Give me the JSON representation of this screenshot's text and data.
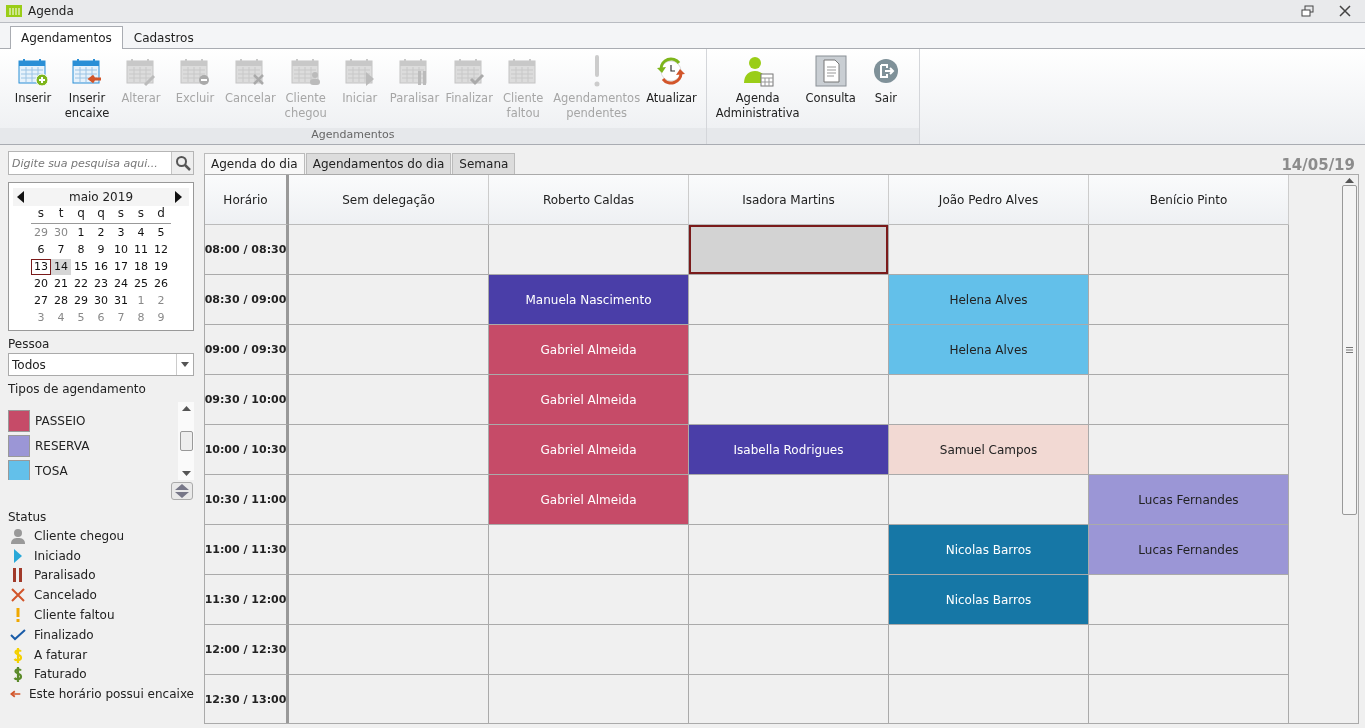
{
  "window": {
    "title": "Agenda"
  },
  "ribbon_tabs": [
    {
      "label": "Agendamentos",
      "selected": true
    },
    {
      "label": "Cadastros",
      "selected": false
    }
  ],
  "ribbon_groups": [
    {
      "label": "Agendamentos",
      "buttons": [
        {
          "lines": [
            "Inserir"
          ],
          "kind": "add",
          "disabled": false
        },
        {
          "lines": [
            "Inserir",
            "encaixe"
          ],
          "kind": "insert",
          "disabled": false
        },
        {
          "lines": [
            "Alterar"
          ],
          "kind": "edit",
          "disabled": true
        },
        {
          "lines": [
            "Excluir"
          ],
          "kind": "remove",
          "disabled": true
        },
        {
          "lines": [
            "Cancelar"
          ],
          "kind": "cancel",
          "disabled": true
        },
        {
          "lines": [
            "Cliente",
            "chegou"
          ],
          "kind": "arrived",
          "disabled": true
        },
        {
          "lines": [
            "Iniciar"
          ],
          "kind": "start",
          "disabled": true
        },
        {
          "lines": [
            "Paralisar"
          ],
          "kind": "pause",
          "disabled": true
        },
        {
          "lines": [
            "Finalizar"
          ],
          "kind": "finish",
          "disabled": true
        },
        {
          "lines": [
            "Cliente",
            "faltou"
          ],
          "kind": "missed",
          "disabled": true
        },
        {
          "lines": [
            "Agendamentos",
            "pendentes"
          ],
          "kind": "pending",
          "disabled": true
        },
        {
          "lines": [
            "Atualizar"
          ],
          "kind": "refresh",
          "disabled": false
        }
      ]
    },
    {
      "buttons": [
        {
          "lines": [
            "Agenda",
            "Administrativa"
          ],
          "kind": "admin",
          "disabled": false
        },
        {
          "lines": [
            "Consulta"
          ],
          "kind": "query",
          "disabled": false
        },
        {
          "lines": [
            "Sair"
          ],
          "kind": "exit",
          "disabled": false
        }
      ]
    }
  ],
  "search": {
    "placeholder": "Digite sua pesquisa aqui..."
  },
  "calendar": {
    "month": "maio 2019",
    "weekdays": [
      "s",
      "t",
      "q",
      "q",
      "s",
      "s",
      "d"
    ],
    "weeks": [
      [
        {
          "day": "29",
          "other_month": true,
          "today": false,
          "selected": false
        },
        {
          "day": "30",
          "other_month": true,
          "today": false,
          "selected": false
        },
        {
          "day": "1",
          "other_month": false,
          "today": false,
          "selected": false
        },
        {
          "day": "2",
          "other_month": false,
          "today": false,
          "selected": false
        },
        {
          "day": "3",
          "other_month": false,
          "today": false,
          "selected": false
        },
        {
          "day": "4",
          "other_month": false,
          "today": false,
          "selected": false
        },
        {
          "day": "5",
          "other_month": false,
          "today": false,
          "selected": false
        }
      ],
      [
        {
          "day": "6",
          "other_month": false,
          "today": false,
          "selected": false
        },
        {
          "day": "7",
          "other_month": false,
          "today": false,
          "selected": false
        },
        {
          "day": "8",
          "other_month": false,
          "today": false,
          "selected": false
        },
        {
          "day": "9",
          "other_month": false,
          "today": false,
          "selected": false
        },
        {
          "day": "10",
          "other_month": false,
          "today": false,
          "selected": false
        },
        {
          "day": "11",
          "other_month": false,
          "today": false,
          "selected": false
        },
        {
          "day": "12",
          "other_month": false,
          "today": false,
          "selected": false
        }
      ],
      [
        {
          "day": "13",
          "other_month": false,
          "today": true,
          "selected": false
        },
        {
          "day": "14",
          "other_month": false,
          "today": false,
          "selected": true
        },
        {
          "day": "15",
          "other_month": false,
          "today": false,
          "selected": false
        },
        {
          "day": "16",
          "other_month": false,
          "today": false,
          "selected": false
        },
        {
          "day": "17",
          "other_month": false,
          "today": false,
          "selected": false
        },
        {
          "day": "18",
          "other_month": false,
          "today": false,
          "selected": false
        },
        {
          "day": "19",
          "other_month": false,
          "today": false,
          "selected": false
        }
      ],
      [
        {
          "day": "20",
          "other_month": false,
          "today": false,
          "selected": false
        },
        {
          "day": "21",
          "other_month": false,
          "today": false,
          "selected": false
        },
        {
          "day": "22",
          "other_month": false,
          "today": false,
          "selected": false
        },
        {
          "day": "23",
          "other_month": false,
          "today": false,
          "selected": false
        },
        {
          "day": "24",
          "other_month": false,
          "today": false,
          "selected": false
        },
        {
          "day": "25",
          "other_month": false,
          "today": false,
          "selected": false
        },
        {
          "day": "26",
          "other_month": false,
          "today": false,
          "selected": false
        }
      ],
      [
        {
          "day": "27",
          "other_month": false,
          "today": false,
          "selected": false
        },
        {
          "day": "28",
          "other_month": false,
          "today": false,
          "selected": false
        },
        {
          "day": "29",
          "other_month": false,
          "today": false,
          "selected": false
        },
        {
          "day": "30",
          "other_month": false,
          "today": false,
          "selected": false
        },
        {
          "day": "31",
          "other_month": false,
          "today": false,
          "selected": false
        },
        {
          "day": "1",
          "other_month": true,
          "today": false,
          "selected": false
        },
        {
          "day": "2",
          "other_month": true,
          "today": false,
          "selected": false
        }
      ],
      [
        {
          "day": "3",
          "other_month": true,
          "today": false,
          "selected": false
        },
        {
          "day": "4",
          "other_month": true,
          "today": false,
          "selected": false
        },
        {
          "day": "5",
          "other_month": true,
          "today": false,
          "selected": false
        },
        {
          "day": "6",
          "other_month": true,
          "today": false,
          "selected": false
        },
        {
          "day": "7",
          "other_month": true,
          "today": false,
          "selected": false
        },
        {
          "day": "8",
          "other_month": true,
          "today": false,
          "selected": false
        },
        {
          "day": "9",
          "other_month": true,
          "today": false,
          "selected": false
        }
      ]
    ]
  },
  "person_filter": {
    "label": "Pessoa",
    "value": "Todos"
  },
  "appointment_types": {
    "label": "Tipos de agendamento",
    "items": [
      {
        "label": "PASSEIO",
        "color": "#c64b68"
      },
      {
        "label": "RESERVA",
        "color": "#9b96d6"
      },
      {
        "label": "TOSA",
        "color": "#63c0ea"
      }
    ]
  },
  "status_legend": {
    "label": "Status",
    "items": [
      {
        "kind": "arrived",
        "label": "Cliente chegou"
      },
      {
        "kind": "started",
        "label": "Iniciado"
      },
      {
        "kind": "paused",
        "label": "Paralisado"
      },
      {
        "kind": "cancelled",
        "label": "Cancelado"
      },
      {
        "kind": "missed",
        "label": "Cliente faltou"
      },
      {
        "kind": "finished",
        "label": "Finalizado"
      },
      {
        "kind": "to_invoice",
        "label": "A faturar"
      },
      {
        "kind": "invoiced",
        "label": "Faturado"
      },
      {
        "kind": "fit_in",
        "label": "Este horário possui encaixe"
      }
    ]
  },
  "view_tabs": [
    {
      "label": "Agenda do dia",
      "selected": true
    },
    {
      "label": "Agendamentos do dia",
      "selected": false
    },
    {
      "label": "Semana",
      "selected": false
    }
  ],
  "date": "14/05/19",
  "schedule": {
    "time_header": "Horário",
    "columns": [
      "Sem delegação",
      "Roberto Caldas",
      "Isadora Martins",
      "João Pedro Alves",
      "Benício Pinto"
    ],
    "rows": [
      {
        "time": "08:00 / 08:30",
        "cells": [
          {
            "kind": "empty"
          },
          {
            "kind": "empty"
          },
          {
            "kind": "selected"
          },
          {
            "kind": "empty"
          },
          {
            "kind": "empty"
          }
        ]
      },
      {
        "time": "08:30 / 09:00",
        "cells": [
          {
            "kind": "empty"
          },
          {
            "kind": "appointment",
            "client": "Manuela Nascimento",
            "color": "#4a3ea8"
          },
          {
            "kind": "empty"
          },
          {
            "kind": "appointment",
            "client": "Helena Alves",
            "color": "#63c0ea"
          },
          {
            "kind": "empty"
          }
        ]
      },
      {
        "time": "09:00 / 09:30",
        "cells": [
          {
            "kind": "empty"
          },
          {
            "kind": "appointment",
            "client": "Gabriel Almeida",
            "color": "#c64b68"
          },
          {
            "kind": "empty"
          },
          {
            "kind": "appointment",
            "client": "Helena Alves",
            "color": "#63c0ea"
          },
          {
            "kind": "empty"
          }
        ]
      },
      {
        "time": "09:30 / 10:00",
        "cells": [
          {
            "kind": "empty"
          },
          {
            "kind": "appointment",
            "client": "Gabriel Almeida",
            "color": "#c64b68"
          },
          {
            "kind": "empty"
          },
          {
            "kind": "empty"
          },
          {
            "kind": "empty"
          }
        ]
      },
      {
        "time": "10:00 / 10:30",
        "cells": [
          {
            "kind": "empty"
          },
          {
            "kind": "appointment",
            "client": "Gabriel Almeida",
            "color": "#c64b68"
          },
          {
            "kind": "appointment",
            "client": "Isabella Rodrigues",
            "color": "#4a3ea8"
          },
          {
            "kind": "appointment",
            "client": "Samuel Campos",
            "color": "#f2d9d3"
          },
          {
            "kind": "empty"
          }
        ]
      },
      {
        "time": "10:30 / 11:00",
        "cells": [
          {
            "kind": "empty"
          },
          {
            "kind": "appointment",
            "client": "Gabriel Almeida",
            "color": "#c64b68"
          },
          {
            "kind": "empty"
          },
          {
            "kind": "empty"
          },
          {
            "kind": "appointment",
            "client": "Lucas Fernandes",
            "color": "#9b96d6"
          }
        ]
      },
      {
        "time": "11:00 / 11:30",
        "cells": [
          {
            "kind": "empty"
          },
          {
            "kind": "empty"
          },
          {
            "kind": "empty"
          },
          {
            "kind": "appointment",
            "client": "Nicolas Barros",
            "color": "#1677a6"
          },
          {
            "kind": "appointment",
            "client": "Lucas Fernandes",
            "color": "#9b96d6"
          }
        ]
      },
      {
        "time": "11:30 / 12:00",
        "cells": [
          {
            "kind": "empty"
          },
          {
            "kind": "empty"
          },
          {
            "kind": "empty"
          },
          {
            "kind": "appointment",
            "client": "Nicolas Barros",
            "color": "#1677a6"
          },
          {
            "kind": "empty"
          }
        ]
      },
      {
        "time": "12:00 / 12:30",
        "cells": [
          {
            "kind": "empty"
          },
          {
            "kind": "empty"
          },
          {
            "kind": "empty"
          },
          {
            "kind": "empty"
          },
          {
            "kind": "empty"
          }
        ]
      },
      {
        "time": "12:30 / 13:00",
        "cells": [
          {
            "kind": "empty"
          },
          {
            "kind": "empty"
          },
          {
            "kind": "empty"
          },
          {
            "kind": "empty"
          },
          {
            "kind": "empty"
          }
        ]
      }
    ]
  }
}
